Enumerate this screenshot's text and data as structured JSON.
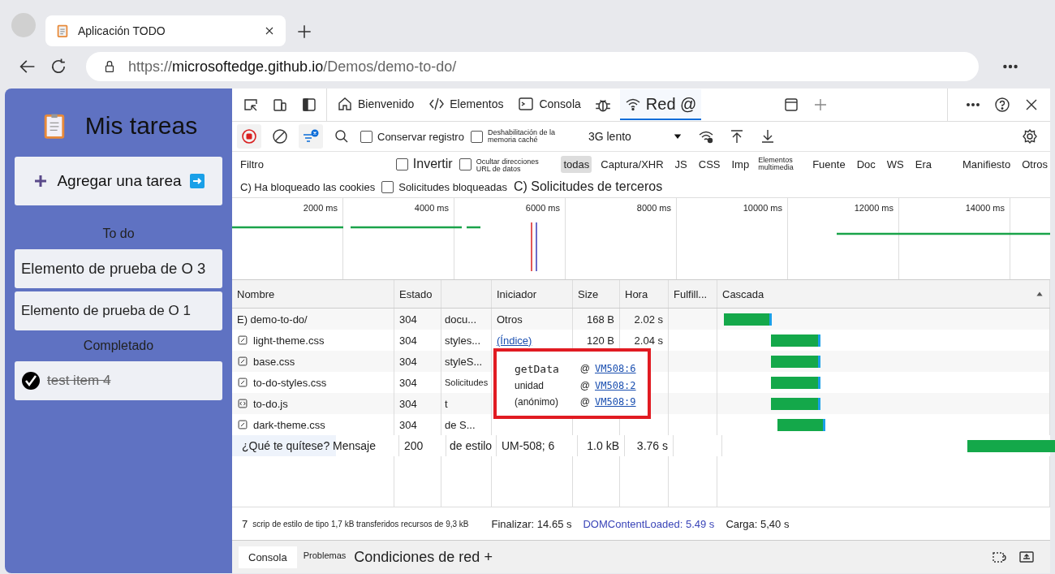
{
  "browser": {
    "tab_title": "Aplicación TODO",
    "url_scheme": "https://",
    "url_host": "microsoftedge.github.io",
    "url_path": "/Demos/demo-to-do/"
  },
  "app": {
    "title": "Mis tareas",
    "add_task": "Agregar una tarea",
    "sections": [
      {
        "heading": "To do",
        "tasks": [
          {
            "text": "Elemento de prueba de O 3",
            "done": false,
            "large": true
          },
          {
            "text": "Elemento de prueba de O 1",
            "done": false,
            "large": false
          }
        ]
      },
      {
        "heading": "Completado",
        "tasks": [
          {
            "text": "test item 4",
            "done": true,
            "large": false
          }
        ]
      }
    ]
  },
  "devtools": {
    "tabs": [
      {
        "label": "Bienvenido",
        "selected": false
      },
      {
        "label": "Elementos",
        "selected": false
      },
      {
        "label": "Consola",
        "selected": false
      },
      {
        "label": "Red @",
        "selected": true
      }
    ],
    "toolbar": {
      "preserve_log": {
        "label": "Conservar registro",
        "checked": false
      },
      "disable_cache": {
        "label": "Deshabilitación de la memoria caché",
        "checked": false
      },
      "throttling": "3G lento"
    },
    "filter": {
      "placeholder": "Filtro",
      "invert": {
        "label": "Invertir",
        "checked": false
      },
      "hide_data_urls": {
        "label": "Ocultar direcciones URL de datos",
        "checked": false
      },
      "types": [
        {
          "label": "todas",
          "selected": true
        },
        {
          "label": "Captura/XHR",
          "selected": false
        },
        {
          "label": "JS",
          "selected": false
        },
        {
          "label": "CSS",
          "selected": false
        },
        {
          "label": "Imp",
          "selected": false
        },
        {
          "label": "Elementos multimedia",
          "selected": false
        },
        {
          "label": "Fuente",
          "selected": false
        },
        {
          "label": "Doc",
          "selected": false
        },
        {
          "label": "WS",
          "selected": false
        },
        {
          "label": "Era",
          "selected": false
        },
        {
          "label": "Manifiesto",
          "selected": false
        },
        {
          "label": "Otros",
          "selected": false
        }
      ],
      "blocked_cookies": "C) Ha bloqueado las cookies",
      "blocked_requests": {
        "label": "Solicitudes bloqueadas",
        "checked": false
      },
      "third_party": "C) Solicitudes de terceros"
    },
    "timeline_ticks": [
      "2000 ms",
      "4000 ms",
      "6000 ms",
      "8000 ms",
      "10000 ms",
      "12000 ms",
      "14000 ms"
    ],
    "table": {
      "columns": [
        "Nombre",
        "Estado",
        "",
        "Iniciador",
        "Size",
        "Hora",
        "Fulfill...",
        "Cascada"
      ],
      "rows": [
        {
          "kind": "plain",
          "name": "E) demo-to-do/",
          "status": "304",
          "type": "docu...",
          "initiator": "Otros",
          "initiator_link": false,
          "size": "168 B",
          "time": "2.02 s",
          "selected": false
        },
        {
          "kind": "stylesheet",
          "name": "light-theme.css",
          "status": "304",
          "type": "styles...",
          "initiator": "(Índice)",
          "initiator_link": true,
          "size": "120 B",
          "time": "2.04 s",
          "selected": false
        },
        {
          "kind": "stylesheet",
          "name": "base.css",
          "status": "304",
          "type": "styleS...",
          "selected": false
        },
        {
          "kind": "stylesheet",
          "name": "to-do-styles.css",
          "status": "304",
          "type": "Solicitudes",
          "selected": false
        },
        {
          "kind": "script",
          "name": "to-do.js",
          "status": "304",
          "type": "t",
          "selected": false
        },
        {
          "kind": "stylesheet",
          "name": "dark-theme.css",
          "status": "304",
          "type": "de S...",
          "selected": false
        },
        {
          "kind": "plain",
          "name": "¿Qué te quítese? Mensaje",
          "status": "200",
          "type": "de estilo",
          "initiator": "UM-508; 6",
          "initiator_link": false,
          "size": "1.0 kB",
          "time": "3.76 s",
          "selected": true
        }
      ]
    },
    "tooltip": {
      "frames": [
        {
          "function": "getData",
          "at": "@",
          "location": "VM508:6"
        },
        {
          "function": "unidad",
          "at": "@",
          "location": "VM508:2"
        },
        {
          "function": "(anónimo)",
          "at": "@",
          "location": "VM508:9"
        }
      ]
    },
    "status_bar": {
      "count": "7",
      "summary": "scrip de estilo de tipo 1,7 kB transferidos recursos de 9,3 kB",
      "finish": "Finalizar: 14.65 s",
      "dom_content_loaded": "DOMContentLoaded: 5.49 s",
      "load": "Carga: 5,40 s"
    },
    "drawer_tabs": [
      {
        "label": "Consola",
        "selected": true
      },
      {
        "label": "Problemas",
        "selected": false
      },
      {
        "label": "Condiciones de red +",
        "selected": false
      }
    ]
  }
}
